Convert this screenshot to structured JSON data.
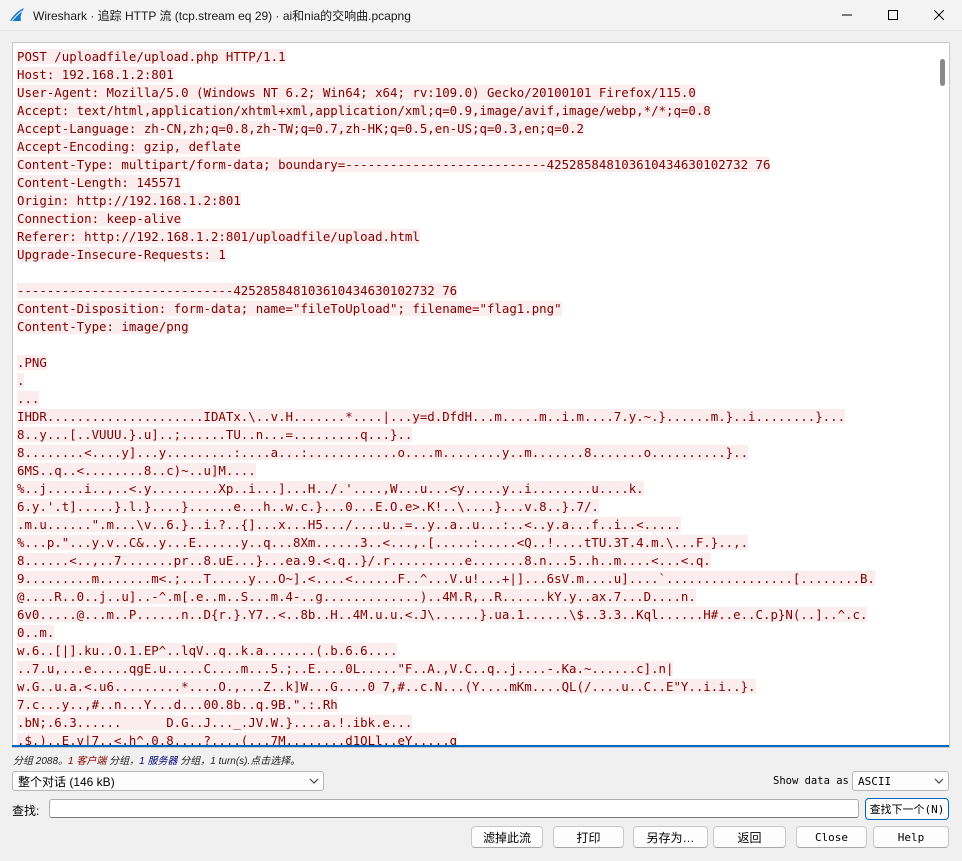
{
  "window": {
    "title": "Wireshark · 追踪 HTTP 流 (tcp.stream eq 29) · ai和nia的交响曲.pcapng",
    "app_icon": "wireshark-fin-icon",
    "accent_color": "#0067c0"
  },
  "stream": {
    "text_color": "#800000",
    "highlight_color": "#fbeded",
    "lines": [
      "POST /uploadfile/upload.php HTTP/1.1",
      "Host: 192.168.1.2:801",
      "User-Agent: Mozilla/5.0 (Windows NT 6.2; Win64; x64; rv:109.0) Gecko/20100101 Firefox/115.0",
      "Accept: text/html,application/xhtml+xml,application/xml;q=0.9,image/avif,image/webp,*/*;q=0.8",
      "Accept-Language: zh-CN,zh;q=0.8,zh-TW;q=0.7,zh-HK;q=0.5,en-US;q=0.3,en;q=0.2",
      "Accept-Encoding: gzip, deflate",
      "Content-Type: multipart/form-data; boundary=---------------------------425285848103610434630102732 76",
      "Content-Length: 145571",
      "Origin: http://192.168.1.2:801",
      "Connection: keep-alive",
      "Referer: http://192.168.1.2:801/uploadfile/upload.html",
      "Upgrade-Insecure-Requests: 1",
      "",
      "-----------------------------425285848103610434630102732 76",
      "Content-Disposition: form-data; name=\"fileToUpload\"; filename=\"flag1.png\"",
      "Content-Type: image/png",
      "",
      ".PNG",
      ".",
      "...",
      "IHDR.....................IDATx.\\..v.H.......*....|...y=d.DfdH...m.....m..i.m....7.y.~.}......m.}..i........}...",
      "8..y...[..VUUU.}.u]..;......TU..n...=.........q...}..",
      "8........<....y]...y.........:....a...:............o....m........y..m.......8.......o..........}..",
      "6MS..q..<........8..c)~..u]M....",
      "%..j.....i..,..<.y.........Xp..i...]...H../.'....,W...u...<y.....y..i........u....k.",
      "6.y.'.t].....}.l.}....}......e...h..w.c.}...0...E.O.e>.K!..\\....}...v.8..}.7/.",
      ".m.u......\".m...\\v..6.}..i.?..{]...x...H5.../....u..=..y..a..u...:..<..y.a...f..i..<.....",
      "%...p.\"...y.v..C&..y...E......y..q...8Xm......3..<...,.[.....:.....<Q..!....tTU.3T.4.m.\\...F.}..,.",
      "8......<..,..7.......pr..8.uE...}...ea.9.<.q..}/.r..........e.......8.n...5..h..m....<...<.q.",
      "9.........m.......m<.;...T.....y...O~].<....<......F..^...V.u!...+|]...6sV.m....u]....`.................[........B.",
      "@....R..0..j..u]..-^.m[.e..m..S...m.4-..g.............)..4M.R,..R......kY.y..ax.7...D....n.",
      "6v0.....@...m..P......n..D{r.}.Y7..<..8b..H..4M.u.u.<.J\\......}.ua.1......\\$..3.3..Kql......H#..e..C.p}N(..]..^.c.",
      "0..m.",
      "w.6..[|].ku..O.1.EP^..lqV..q..k.a.......(.b.6.6....",
      "..7.u,...e.....qgE.u.....C....m...5.;..E....0L.....\"F..A.,V.C..q..j....-.Ka.~......c].n|",
      "w.G..u.a.<.u6.........*....O.,...Z..k]W...G....0 7,#..c.N...(Y....mKm....QL(/....u..C..E\"Y..i.i..}.",
      "7.c...y..,#..n...Y...d...00.8b..q.9B.\".:.Rh",
      ".bN;.6.3......      D.G..J..._.JV.W.}....a.!.ibk.e...",
      ".$.)..E.v|7..<.h^.0.8....?....(...7M........d1QLl..eY.....g"
    ]
  },
  "status": {
    "prefix": "分组 2088。",
    "client_packets": "1 客户端",
    "mid1": " 分组，",
    "server_packets": "1 服务器",
    "suffix": " 分组，1 turn(s).点击选择。"
  },
  "controls": {
    "conversation_select": "整个对话 (146 kB)",
    "show_data_label": "Show data as",
    "show_data_value": "ASCII",
    "find_label": "查找:",
    "find_value": "",
    "find_next_label": "查找下一个(N)"
  },
  "buttons": {
    "filter_out": "滤掉此流",
    "print": "打印",
    "save_as": "另存为…",
    "back": "返回",
    "close": "Close",
    "help": "Help"
  }
}
